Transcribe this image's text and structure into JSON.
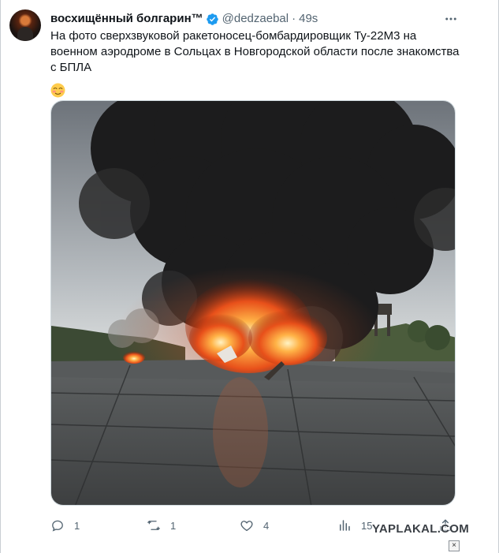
{
  "tweet": {
    "display_name": "восхищённый болгарин™",
    "handle": "@dedzaebal",
    "separator": "·",
    "time": "49s",
    "text": "На фото сверхзвуковой ракетоносец-бомбардировщик Ту-22М3 на военном аэродроме в Сольцах в Новгородской области после знакомства с БПЛА",
    "emoji_icon": "blushing-face-emoji"
  },
  "actions": {
    "replies": "1",
    "retweets": "1",
    "likes": "4",
    "views": "15"
  },
  "watermark": "YAPLAKAL.COM",
  "close_label": "×",
  "colors": {
    "text": "#0f1419",
    "secondary": "#536471",
    "verified": "#1d9bf0",
    "border": "#cfd9de"
  },
  "icons": [
    "verified-badge-icon",
    "more-icon",
    "reply-icon",
    "retweet-icon",
    "like-icon",
    "views-icon",
    "share-icon"
  ]
}
